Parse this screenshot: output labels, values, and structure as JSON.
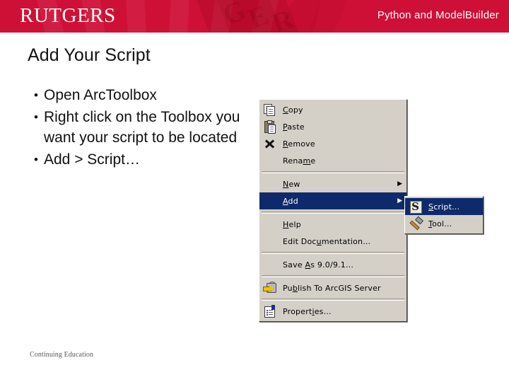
{
  "header": {
    "logo": "RUTGERS",
    "title": "Python and ModelBuilder",
    "bg_color": "#cf1036"
  },
  "slide": {
    "title": "Add Your Script",
    "bullets": [
      {
        "marker": "•",
        "text": "Open ArcToolbox"
      },
      {
        "marker": "•",
        "text": "Right click on the Toolbox you want your script to be located"
      },
      {
        "marker": "•",
        "text": "Add > Script…"
      }
    ],
    "footer": "Continuing Education"
  },
  "context_menu": {
    "highlight_color": "#0f2a6b",
    "background_color": "#d4d0c8",
    "items": [
      {
        "icon": "copy-icon",
        "label": "Copy",
        "accel": "C",
        "submenu_arrow": "",
        "selected": false,
        "separator_after": false
      },
      {
        "icon": "paste-icon",
        "label": "Paste",
        "accel": "P",
        "submenu_arrow": "",
        "selected": false,
        "separator_after": false
      },
      {
        "icon": "remove-icon",
        "label": "Remove",
        "accel": "R",
        "submenu_arrow": "",
        "selected": false,
        "separator_after": false
      },
      {
        "icon": "",
        "label": "Rename",
        "accel": "m",
        "submenu_arrow": "",
        "selected": false,
        "separator_after": true
      },
      {
        "icon": "",
        "label": "New",
        "accel": "N",
        "submenu_arrow": "▶",
        "selected": false,
        "separator_after": false
      },
      {
        "icon": "",
        "label": "Add",
        "accel": "A",
        "submenu_arrow": "▶",
        "selected": true,
        "separator_after": true
      },
      {
        "icon": "",
        "label": "Help",
        "accel": "H",
        "submenu_arrow": "",
        "selected": false,
        "separator_after": false
      },
      {
        "icon": "",
        "label": "Edit Documentation...",
        "accel": "u",
        "submenu_arrow": "",
        "selected": false,
        "separator_after": true
      },
      {
        "icon": "",
        "label": "Save As 9.0/9.1...",
        "accel": "A",
        "submenu_arrow": "",
        "selected": false,
        "separator_after": true
      },
      {
        "icon": "publish-icon",
        "label": "Publish To ArcGIS Server",
        "accel": "b",
        "submenu_arrow": "",
        "selected": false,
        "separator_after": true
      },
      {
        "icon": "properties-icon",
        "label": "Properties...",
        "accel": "i",
        "submenu_arrow": "",
        "selected": false,
        "separator_after": false
      }
    ],
    "submenu": {
      "items": [
        {
          "icon": "script-icon",
          "label": "Script...",
          "accel": "S",
          "selected": true
        },
        {
          "icon": "tool-icon",
          "label": "Tool...",
          "accel": "T",
          "selected": false
        }
      ]
    }
  }
}
